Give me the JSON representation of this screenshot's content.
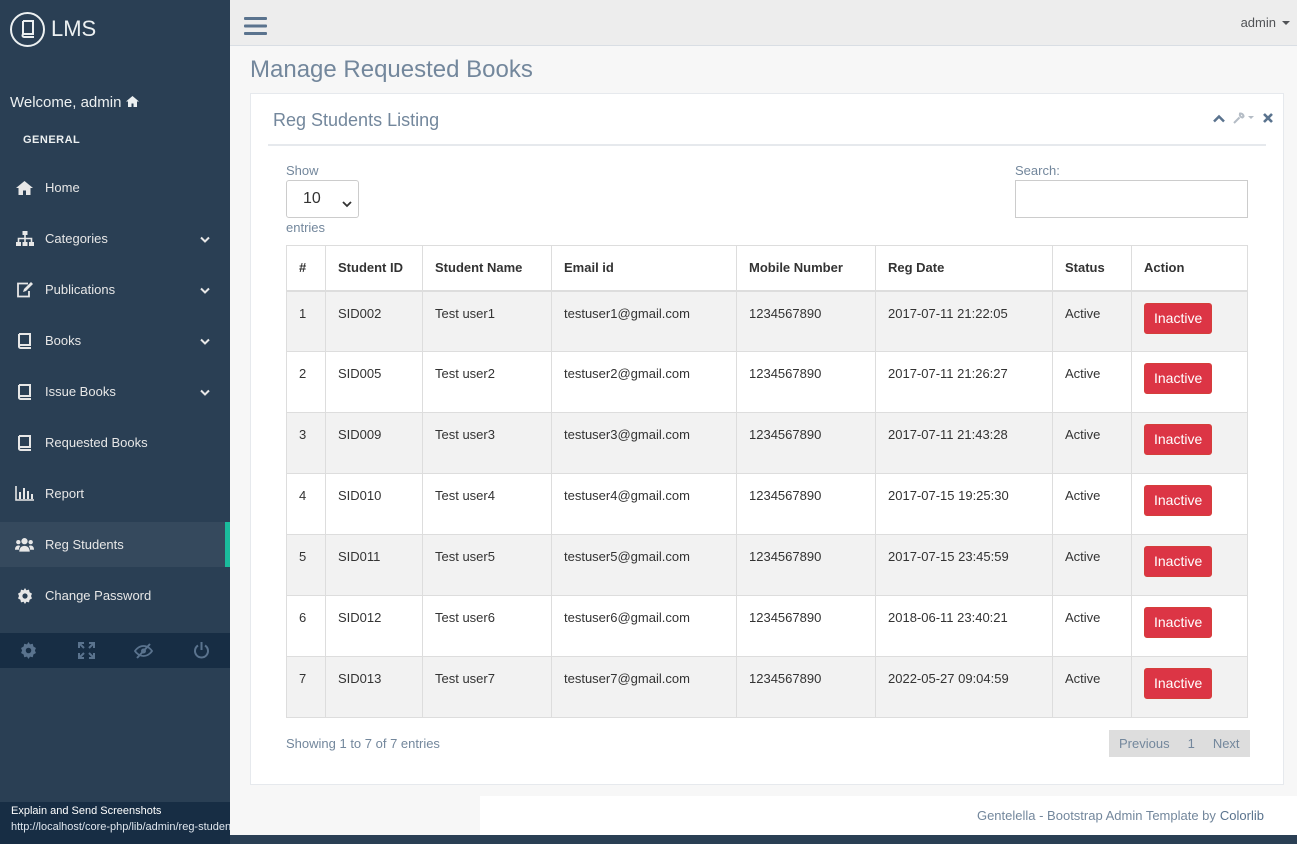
{
  "brand": {
    "title": "LMS",
    "icon": "book-icon"
  },
  "welcome": {
    "text": "Welcome, admin",
    "icon": "home-icon"
  },
  "sidebar": {
    "section": "GENERAL",
    "items": [
      {
        "label": "Home",
        "icon": "home-icon",
        "has_children": false
      },
      {
        "label": "Categories",
        "icon": "sitemap-icon",
        "has_children": true
      },
      {
        "label": "Publications",
        "icon": "edit-icon",
        "has_children": true
      },
      {
        "label": "Books",
        "icon": "book-icon",
        "has_children": true
      },
      {
        "label": "Issue Books",
        "icon": "book-icon",
        "has_children": true
      },
      {
        "label": "Requested Books",
        "icon": "book-icon",
        "has_children": false
      },
      {
        "label": "Report",
        "icon": "bar-chart-icon",
        "has_children": false
      },
      {
        "label": "Reg Students",
        "icon": "users-icon",
        "has_children": false,
        "active": true
      },
      {
        "label": "Change Password",
        "icon": "gear-icon",
        "has_children": false
      }
    ],
    "footer_icons": [
      "settings-icon",
      "fullscreen-icon",
      "eye-slash-icon",
      "power-icon"
    ]
  },
  "topnav": {
    "user": "admin"
  },
  "page": {
    "title": "Manage Requested Books"
  },
  "panel": {
    "title": "Reg Students Listing",
    "show_label": "Show",
    "page_size": "10",
    "entries_label": "entries",
    "search_label": "Search:",
    "search_value": "",
    "columns": [
      "#",
      "Student ID",
      "Student Name",
      "Email id",
      "Mobile Number",
      "Reg Date",
      "Status",
      "Action"
    ],
    "rows": [
      {
        "n": "1",
        "id": "SID002",
        "name": "Test user1",
        "email": "testuser1@gmail.com",
        "mobile": "1234567890",
        "date": "2017-07-11 21:22:05",
        "status": "Active",
        "action": "Inactive"
      },
      {
        "n": "2",
        "id": "SID005",
        "name": "Test user2",
        "email": "testuser2@gmail.com",
        "mobile": "1234567890",
        "date": "2017-07-11 21:26:27",
        "status": "Active",
        "action": "Inactive"
      },
      {
        "n": "3",
        "id": "SID009",
        "name": "Test user3",
        "email": "testuser3@gmail.com",
        "mobile": "1234567890",
        "date": "2017-07-11 21:43:28",
        "status": "Active",
        "action": "Inactive"
      },
      {
        "n": "4",
        "id": "SID010",
        "name": "Test user4",
        "email": "testuser4@gmail.com",
        "mobile": "1234567890",
        "date": "2017-07-15 19:25:30",
        "status": "Active",
        "action": "Inactive"
      },
      {
        "n": "5",
        "id": "SID011",
        "name": "Test user5",
        "email": "testuser5@gmail.com",
        "mobile": "1234567890",
        "date": "2017-07-15 23:45:59",
        "status": "Active",
        "action": "Inactive"
      },
      {
        "n": "6",
        "id": "SID012",
        "name": "Test user6",
        "email": "testuser6@gmail.com",
        "mobile": "1234567890",
        "date": "2018-06-11 23:40:21",
        "status": "Active",
        "action": "Inactive"
      },
      {
        "n": "7",
        "id": "SID013",
        "name": "Test user7",
        "email": "testuser7@gmail.com",
        "mobile": "1234567890",
        "date": "2022-05-27 09:04:59",
        "status": "Active",
        "action": "Inactive"
      }
    ],
    "info": "Showing 1 to 7 of 7 entries",
    "pagination": {
      "previous": "Previous",
      "current": "1",
      "next": "Next"
    }
  },
  "footer": {
    "text": "Gentelella - Bootstrap Admin Template by",
    "link": "Colorlib"
  },
  "status_overlay": {
    "line1": "Explain and Send Screenshots",
    "url": "http://localhost/core-php/lib/admin/reg-students.php"
  },
  "colors": {
    "sidebar": "#2A3F54",
    "accent": "#1ABB9C",
    "danger": "#dc3545",
    "text": "#73879C"
  }
}
